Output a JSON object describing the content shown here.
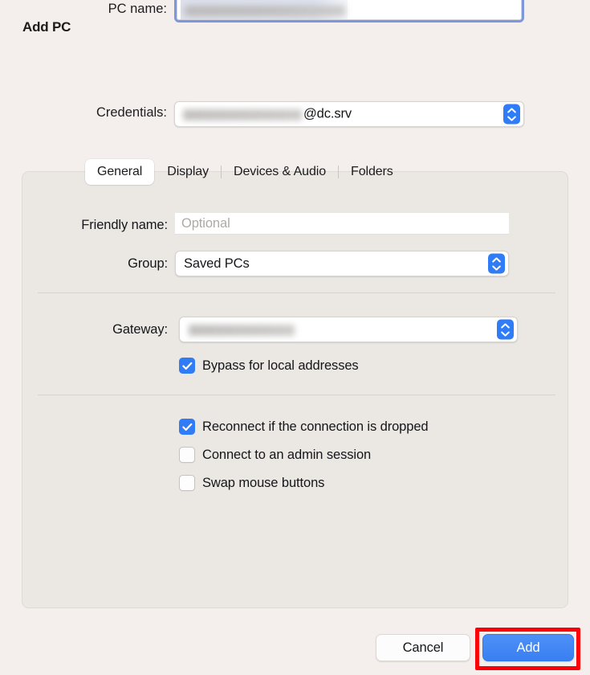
{
  "dialog": {
    "title": "Add PC"
  },
  "fields": {
    "pc_name": {
      "label": "PC name:",
      "value": "",
      "redacted": true,
      "focused": true
    },
    "credentials": {
      "label": "Credentials:",
      "value_visible_suffix": "@dc.srv",
      "redacted_prefix": true
    }
  },
  "tabs": [
    {
      "label": "General",
      "selected": true
    },
    {
      "label": "Display",
      "selected": false
    },
    {
      "label": "Devices & Audio",
      "selected": false
    },
    {
      "label": "Folders",
      "selected": false
    }
  ],
  "general": {
    "friendly_name": {
      "label": "Friendly name:",
      "value": "",
      "placeholder": "Optional"
    },
    "group": {
      "label": "Group:",
      "value": "Saved PCs"
    },
    "gateway": {
      "label": "Gateway:",
      "value": "",
      "redacted": true
    },
    "checkboxes": [
      {
        "label": "Bypass for local addresses",
        "checked": true
      },
      {
        "label": "Reconnect if the connection is dropped",
        "checked": true
      },
      {
        "label": "Connect to an admin session",
        "checked": false
      },
      {
        "label": "Swap mouse buttons",
        "checked": false
      }
    ]
  },
  "footer": {
    "cancel_label": "Cancel",
    "add_label": "Add"
  },
  "colors": {
    "window_background": "#f4efec",
    "panel_background": "#ebe8e4",
    "accent_blue": "#2f7cf6",
    "default_button_blue": "#3a7ff2",
    "focus_ring": "#7d97da",
    "highlight_red": "#fb0007",
    "placeholder_gray": "#adaaa6"
  }
}
